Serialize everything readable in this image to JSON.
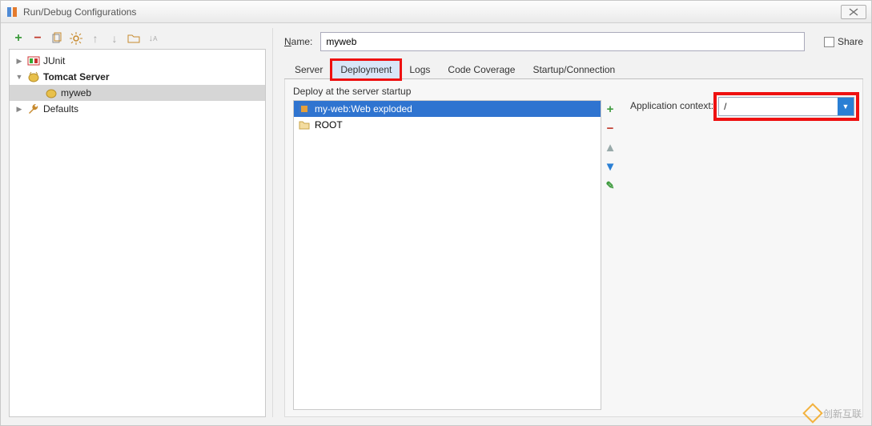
{
  "window": {
    "title": "Run/Debug Configurations"
  },
  "name": {
    "label": "Name:",
    "value": "myweb",
    "share_label": "Share"
  },
  "tree": {
    "items": [
      {
        "label": "JUnit"
      },
      {
        "label": "Tomcat Server"
      },
      {
        "label": "myweb"
      },
      {
        "label": "Defaults"
      }
    ]
  },
  "tabs": {
    "server_partial": "Server",
    "deployment": "Deployment",
    "logs": "Logs",
    "code_coverage": "Code Coverage",
    "startup": "Startup/Connection"
  },
  "deploy": {
    "section_label": "Deploy at the server startup",
    "artifacts": [
      {
        "label": "my-web:Web exploded"
      },
      {
        "label": "ROOT"
      }
    ]
  },
  "context": {
    "label": "Application context:",
    "value": "/"
  },
  "watermark": "创新互联"
}
